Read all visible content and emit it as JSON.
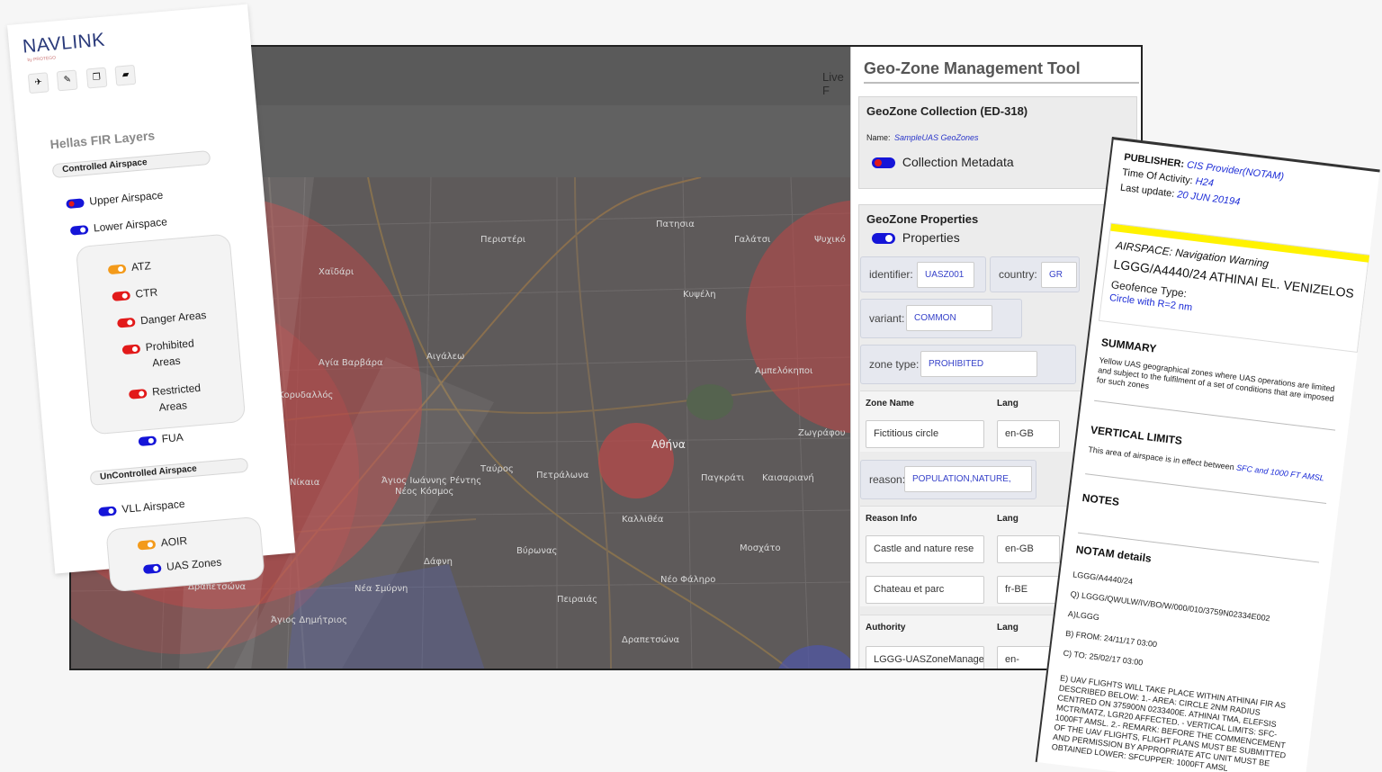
{
  "main": {
    "live_label": "Live F"
  },
  "map": {
    "places": [
      "Πατησια",
      "Γαλάτσι",
      "Ψυχικό",
      "Περιστέρι",
      "Χαϊδάρι",
      "Αιγάλεω",
      "Κυψέλη",
      "Αγία Βαρβάρα",
      "Αμπελόκηποι",
      "Κορυδαλλός",
      "Αθήνα",
      "Ζωγράφου",
      "Ταύρος",
      "Πετράλωνα",
      "Παγκράτι",
      "Καισαριανή",
      "Νίκαια",
      "Άγιος Ιωάννης Ρέντης",
      "Νέος Κόσμος",
      "Καλλιθέα",
      "Βύρωνας",
      "Μοσχάτο",
      "Δάφνη",
      "Νέο Φάληρο",
      "Νέα Σμύρνη",
      "Πειραιάς",
      "Άγιος Δημήτριος",
      "Δραπετσώνα"
    ]
  },
  "geozone": {
    "title": "Geo-Zone Management Tool",
    "collection": {
      "heading": "GeoZone Collection (ED-318)",
      "name_label": "Name:",
      "name_value": "SampleUAS GeoZones",
      "metadata_label": "Collection Metadata"
    },
    "properties": {
      "heading": "GeoZone Properties",
      "toggle_label": "Properties",
      "identifier_label": "identifier:",
      "identifier_value": "UASZ001",
      "country_label": "country:",
      "country_value": "GR",
      "variant_label": "variant:",
      "variant_value": "COMMON",
      "zone_type_label": "zone type:",
      "zone_type_value": "PROHIBITED",
      "zone_name_header": "Zone Name",
      "lang_header": "Lang",
      "zone_name_value": "Fictitious circle",
      "zone_name_lang": "en-GB",
      "reason_label": "reason:",
      "reason_value": "POPULATION,NATURE,",
      "reason_info_header": "Reason Info",
      "reason_info_1": "Castle and nature rese",
      "reason_info_1_lang": "en-GB",
      "reason_info_2": "Chateau et parc",
      "reason_info_2_lang": "fr-BE",
      "authority_header": "Authority",
      "authority_value": "LGGG-UASZoneManage",
      "authority_lang": "en-"
    }
  },
  "navlink": {
    "logo": "NAVLINK",
    "logo_sub": "by PROTEGO",
    "tools": [
      "plane-icon",
      "edit-icon",
      "copy-icon",
      "folder-icon"
    ],
    "layers_title": "Hellas FIR Layers",
    "controlled_label": "Controlled Airspace",
    "upper_label": "Upper Airspace",
    "lower_label": "Lower Airspace",
    "atz_label": "ATZ",
    "ctr_label": "CTR",
    "danger_label": "Danger Areas",
    "prohibited_label_1": "Prohibited",
    "prohibited_label_2": "Areas",
    "restricted_label_1": "Restricted",
    "restricted_label_2": "Areas",
    "fua_label": "FUA",
    "uncontrolled_label": "UnControlled Airspace",
    "vll_label": "VLL Airspace",
    "aoir_label": "AOIR",
    "uas_label": "UAS Zones"
  },
  "notam": {
    "publisher_label": "PUBLISHER:",
    "publisher_value": "CIS Provider(NOTAM)",
    "activity_label": "Time Of Activity:",
    "activity_value": "H24",
    "update_label": "Last update:",
    "update_value": "20 JUN 20194",
    "airspace_label": "AIRSPACE: Navigation Warning",
    "airspace_id": "LGGG/A4440/24 ATHINAI EL. VENIZELOS",
    "geofence_label": "Geofence Type:",
    "geofence_value": "Circle with R=2 nm",
    "summary_heading": "SUMMARY",
    "summary_text": "Yellow UAS geographical zones where UAS operations are limited and subject to the fulfilment of a set of conditions that are imposed for such zones",
    "vertical_heading": "VERTICAL LIMITS",
    "vertical_text": "This area of airspace is in effect between",
    "vertical_value": "SFC and 1000 FT AMSL",
    "notes_heading": "NOTES",
    "details_heading": "NOTAM details",
    "details_lines": [
      "LGGG/A4440/24",
      "Q) LGGG/QWULW/IV/BO/W/000/010/3759N02334E002",
      "A)LGGG",
      "B) FROM: 24/11/17 03:00",
      "C) TO: 25/02/17 03:00"
    ],
    "details_e": "E) UAV FLIGHTS WILL TAKE PLACE WITHIN ATHINAI FIR AS DESCRIBED BELOW: 1.- AREA: CIRCLE 2NM RADIUS CENTRED ON 375900N 0233400E. ATHINAI TMA, ELEFSIS MCTR/MATZ, LGR20 AFFECTED. - VERTICAL LIMITS: SFC-1000FT AMSL. 2.- REMARK: BEFORE THE COMMENCEMENT OF THE UAV FLIGHTS, FLIGHT PLANS MUST BE SUBMITTED AND PERMISSION BY APPROPRIATE ATC UNIT MUST BE OBTAINED LOWER: SFCUPPER: 1000FT AMSL"
  }
}
